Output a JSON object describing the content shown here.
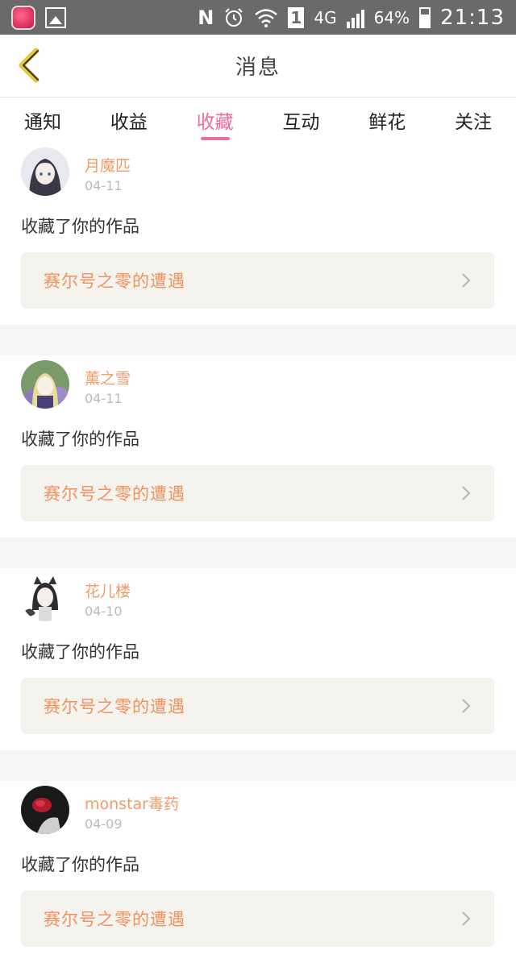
{
  "status_bar": {
    "network_n": "N",
    "sim": "1",
    "net_type": "4G",
    "battery": "64%",
    "time": "21:13"
  },
  "header": {
    "title": "消息",
    "back_icon": "chevron-left-icon",
    "accent_color": "#ef6b9c"
  },
  "tabs": [
    "通知",
    "收益",
    "收藏",
    "互动",
    "鲜花",
    "关注"
  ],
  "active_tab": "收藏",
  "feed": [
    {
      "user": "月魔匹",
      "date": "04-11",
      "action": "收藏了你的作品",
      "work": "赛尔号之零的遭遇",
      "avatar": "avatar-anime-girl-dark-hair"
    },
    {
      "user": "薰之雪",
      "date": "04-11",
      "action": "收藏了你的作品",
      "work": "赛尔号之零的遭遇",
      "avatar": "avatar-anime-girl-flowers"
    },
    {
      "user": "花儿楼",
      "date": "04-10",
      "action": "收藏了你的作品",
      "work": "赛尔号之零的遭遇",
      "avatar": "avatar-anime-girl-cat-ears"
    },
    {
      "user": "monstar毒药",
      "date": "04-09",
      "action": "收藏了你的作品",
      "work": "赛尔号之零的遭遇",
      "avatar": "avatar-dark-rose"
    }
  ]
}
